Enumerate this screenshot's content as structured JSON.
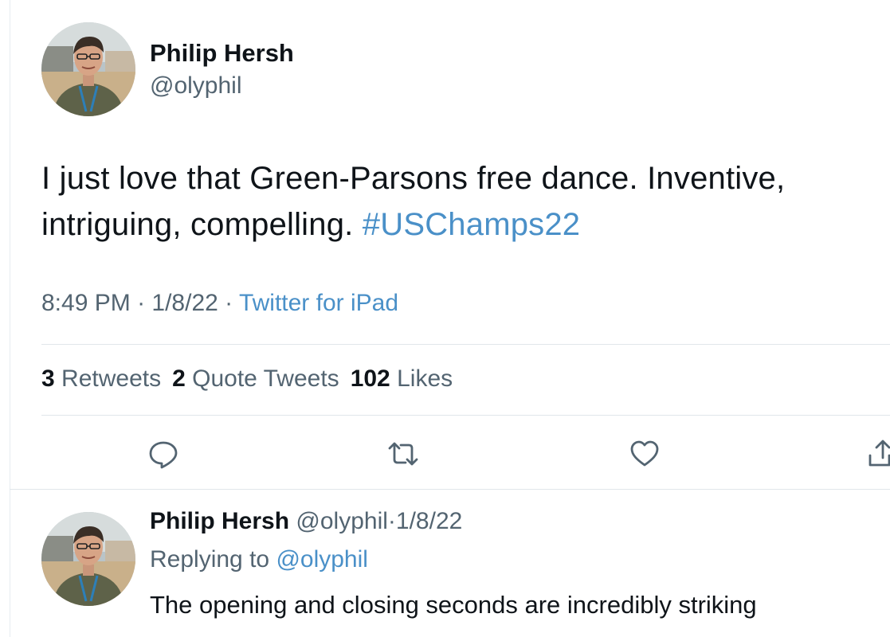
{
  "tweet": {
    "author_name": "Philip Hersh",
    "author_handle": "@olyphil",
    "text_main": "I just love that Green-Parsons free dance.  Inventive, intriguing, compelling.  ",
    "hashtag": "#USChamps22",
    "time": "8:49 PM",
    "separator": " · ",
    "date": "1/8/22",
    "source": "Twitter for iPad",
    "stats": {
      "retweets_count": "3",
      "retweets_label": "Retweets",
      "quotes_count": "2",
      "quotes_label": "Quote Tweets",
      "likes_count": "102",
      "likes_label": "Likes"
    },
    "actions": [
      "reply-icon",
      "retweet-icon",
      "like-icon",
      "share-icon"
    ]
  },
  "reply": {
    "author_name": "Philip Hersh",
    "author_handle": "@olyphil",
    "separator": "·",
    "date": "1/8/22",
    "replying_label": "Replying to",
    "replying_to": "@olyphil",
    "text": "The opening and closing seconds are incredibly striking"
  },
  "colors": {
    "link": "#4a90c8",
    "secondary_text": "#536471",
    "primary_text": "#0f1419"
  }
}
